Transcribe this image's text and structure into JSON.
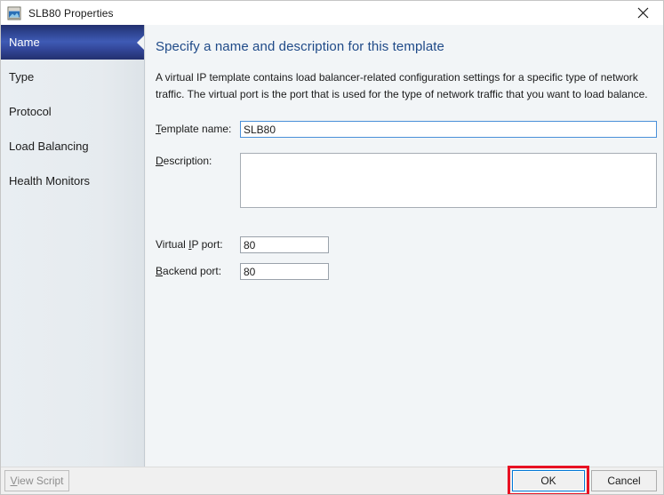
{
  "window": {
    "title": "SLB80 Properties",
    "icon": "template-properties-icon",
    "close_label": "✕"
  },
  "sidebar": {
    "items": [
      {
        "label": "Name",
        "selected": true
      },
      {
        "label": "Type",
        "selected": false
      },
      {
        "label": "Protocol",
        "selected": false
      },
      {
        "label": "Load Balancing",
        "selected": false
      },
      {
        "label": "Health Monitors",
        "selected": false
      }
    ]
  },
  "content": {
    "heading": "Specify a name and description for this template",
    "body": "A virtual IP template contains load balancer-related configuration settings for a specific type of network traffic. The virtual port is the port that is used for the type of network traffic that you want to load balance."
  },
  "form": {
    "template_name": {
      "label_prefix": "",
      "label_accel": "T",
      "label_suffix": "emplate name:",
      "value": "SLB80",
      "placeholder": ""
    },
    "description": {
      "label_prefix": "",
      "label_accel": "D",
      "label_suffix": "escription:",
      "value": "",
      "placeholder": ""
    },
    "virtual_ip_port": {
      "label_prefix": "Virtual ",
      "label_accel": "I",
      "label_suffix": "P port:",
      "value": "80",
      "placeholder": ""
    },
    "backend_port": {
      "label_prefix": "",
      "label_accel": "B",
      "label_suffix": "ackend port:",
      "value": "80",
      "placeholder": ""
    }
  },
  "footer": {
    "view_script": {
      "accel": "V",
      "suffix": "iew Script",
      "enabled": false
    },
    "ok_label": "OK",
    "cancel_label": "Cancel"
  },
  "annotation": {
    "target": "ok-button",
    "color": "#e81123"
  },
  "colors": {
    "accent_blue": "#1f4a88",
    "selected_nav": "#2e4490",
    "focus_border": "#4a90d9",
    "annotation_red": "#e81123",
    "content_bg": "#f2f5f7",
    "sidebar_bg": "#e6ebef",
    "footer_bg": "#f0f0f0"
  }
}
